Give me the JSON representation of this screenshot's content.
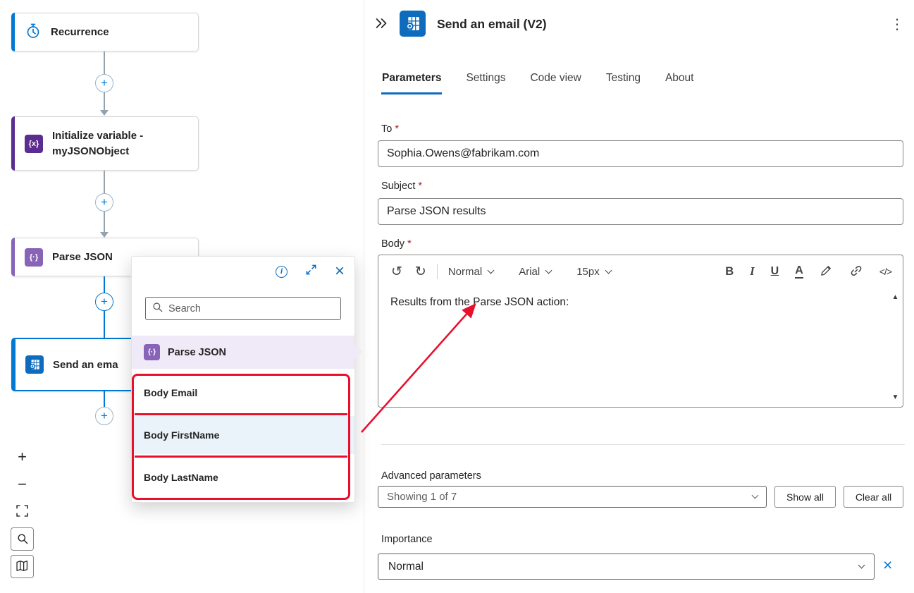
{
  "canvas": {
    "nodes": {
      "recurrence": {
        "label": "Recurrence"
      },
      "initialize": {
        "label_line1": "Initialize variable -",
        "label_line2": "myJSONObject"
      },
      "parse_json": {
        "label": "Parse JSON"
      },
      "send_email": {
        "label": "Send an ema"
      }
    }
  },
  "picker": {
    "search_placeholder": "Search",
    "group_label": "Parse JSON",
    "items": [
      "Body Email",
      "Body FirstName",
      "Body LastName"
    ]
  },
  "panel": {
    "title": "Send an email (V2)",
    "tabs": [
      "Parameters",
      "Settings",
      "Code view",
      "Testing",
      "About"
    ],
    "required_mark": "*",
    "to_label": "To",
    "to_value": "Sophia.Owens@fabrikam.com",
    "subject_label": "Subject",
    "subject_value": "Parse JSON results",
    "body_label": "Body",
    "body_text": "Results from the Parse JSON action:",
    "editor": {
      "style": "Normal",
      "font": "Arial",
      "size": "15px",
      "bold": "B",
      "italic": "I",
      "underline": "U",
      "font_color": "A"
    },
    "advanced_label": "Advanced parameters",
    "advanced_value": "Showing 1 of 7",
    "show_all": "Show all",
    "clear_all": "Clear all",
    "importance_label": "Importance",
    "importance_value": "Normal"
  },
  "icons": {
    "undo": "↺",
    "redo": "↻",
    "more": "⋮",
    "close": "×",
    "info": "i",
    "scroll_up": "▲",
    "scroll_down": "▼",
    "plus": "+",
    "minus": "−",
    "init_glyph": "{x}",
    "parse_glyph": "{·}",
    "code": "</>"
  },
  "colors": {
    "accent_blue": "#0078d4",
    "outlook_blue": "#0f6cbd",
    "purple": "#5c2d91",
    "light_purple": "#8764b8",
    "annotation_red": "#e8112d"
  }
}
